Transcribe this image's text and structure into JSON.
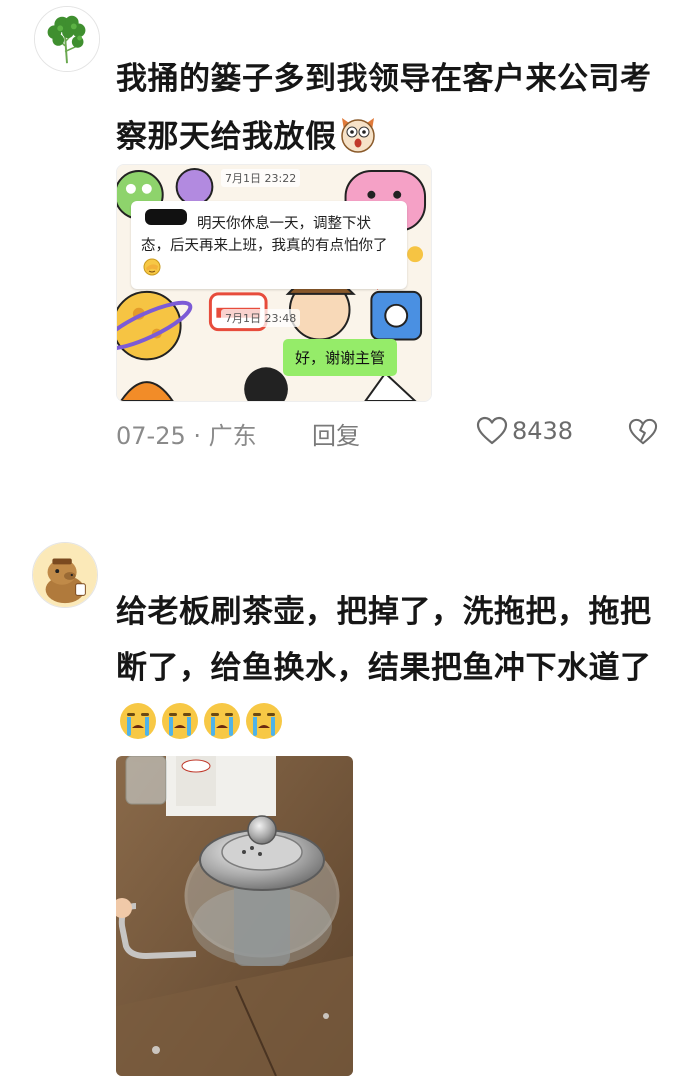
{
  "comments": [
    {
      "avatar_icon": "cilantro-icon",
      "text": "我捅的篓子多到我领导在客户来公司考察那天给我放假",
      "emoji": "shocked-dog-emoji",
      "attachment": {
        "type": "chat-screenshot",
        "timestamp_1": "7月1日 23:22",
        "incoming_message": "明天你休息一天，调整下状态，后天再来上班，我真的有点怕你了",
        "incoming_emoji": "facepalm-emoji",
        "timestamp_2": "7月1日 23:48",
        "outgoing_message": "好，谢谢主管"
      },
      "date": "07-25",
      "location": "广东",
      "date_location": "07-25 · 广东",
      "reply_label": "回复",
      "likes": "8438"
    },
    {
      "avatar_icon": "capybara-icon",
      "text": "给老板刷茶壶，把掉了，洗拖把，拖把断了，给鱼换水，结果把鱼冲下水道了",
      "emoji": "crying-face-emoji",
      "emoji_count": 4,
      "attachment": {
        "type": "photo",
        "subject": "broken-glass-teapot-photo"
      }
    }
  ],
  "colors": {
    "primary_text": "#161616",
    "meta_text": "#8a8a8a",
    "outgoing_bubble": "#95ec69"
  }
}
